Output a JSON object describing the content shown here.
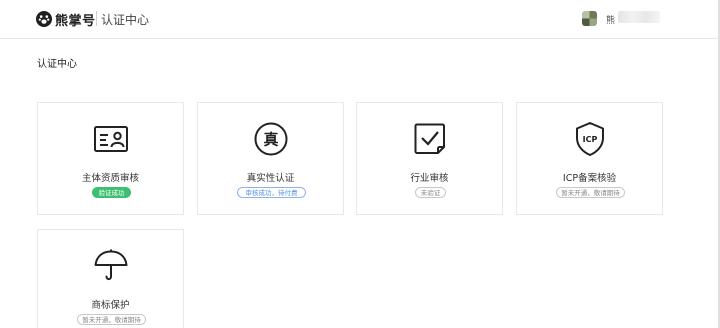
{
  "header": {
    "brand_name": "熊掌号",
    "app_title": "认证中心",
    "user_name_prefix": "熊",
    "avatar_icon": "avatar-icon",
    "logo_icon": "paw-icon"
  },
  "main": {
    "page_title": "认证中心",
    "cards": [
      {
        "label": "主体资质审核",
        "icon": "id-card-icon",
        "status": "验证成功",
        "status_type": "success"
      },
      {
        "label": "真实性认证",
        "icon": "zhen-seal-icon",
        "status": "审核成功，待付费",
        "status_type": "pending"
      },
      {
        "label": "行业审核",
        "icon": "checkbox-icon",
        "status": "未验证",
        "status_type": "neutral"
      },
      {
        "label": "ICP备案核验",
        "icon": "icp-shield-icon",
        "icon_text": "ICP",
        "status": "暂未开通，敬请期待",
        "status_type": "neutral"
      },
      {
        "label": "商标保护",
        "icon": "umbrella-icon",
        "status": "暂未开通，敬请期待",
        "status_type": "neutral"
      }
    ],
    "seal_char": "真"
  },
  "colors": {
    "success": "#3dbf73",
    "pending_text": "#5a8ee8",
    "neutral_text": "#888888",
    "background": "#f4f5f7"
  }
}
